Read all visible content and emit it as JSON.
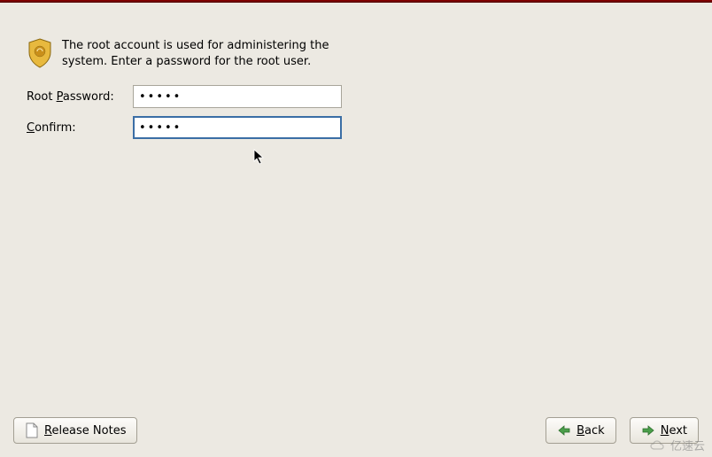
{
  "instruction": "The root account is used for administering the system.  Enter a password for the root user.",
  "form": {
    "root_password_label_pre": "Root ",
    "root_password_mnemonic": "P",
    "root_password_label_post": "assword:",
    "root_password_value": "•••••",
    "confirm_mnemonic": "C",
    "confirm_label_post": "onfirm:",
    "confirm_value": "•••••"
  },
  "buttons": {
    "release_notes_mnemonic": "R",
    "release_notes_post": "elease Notes",
    "back_mnemonic": "B",
    "back_post": "ack",
    "next_mnemonic": "N",
    "next_post": "ext"
  },
  "watermark": "亿速云"
}
